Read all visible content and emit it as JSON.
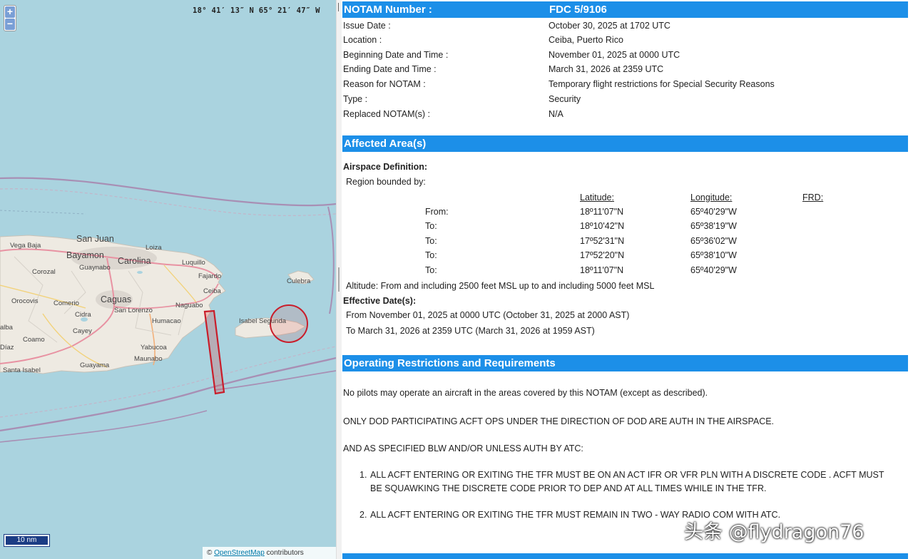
{
  "map": {
    "zoom_in": "+",
    "zoom_out": "−",
    "coordinates": "18° 41′ 13″ N 65° 21′ 47″ W",
    "scale": "10 nm",
    "attribution_symbol": "©",
    "attribution_link": "OpenStreetMap",
    "attribution_suffix": " contributors",
    "places": [
      {
        "name": "San Juan",
        "big": true
      },
      {
        "name": "Bayamon",
        "big": true
      },
      {
        "name": "Carolina",
        "big": true
      },
      {
        "name": "Caguas",
        "big": true
      },
      {
        "name": "Vega Baja"
      },
      {
        "name": "Loiza"
      },
      {
        "name": "Guaynabo"
      },
      {
        "name": "Luquillo"
      },
      {
        "name": "Corozal"
      },
      {
        "name": "Fajardo"
      },
      {
        "name": "Ceiba"
      },
      {
        "name": "Culebra"
      },
      {
        "name": "Orocovis"
      },
      {
        "name": "Comerio"
      },
      {
        "name": "Naguabo"
      },
      {
        "name": "Cidra"
      },
      {
        "name": "San Lorenzo"
      },
      {
        "name": "Humacao"
      },
      {
        "name": "Isabel Segunda"
      },
      {
        "name": "alba"
      },
      {
        "name": "Cayey"
      },
      {
        "name": "Coamo"
      },
      {
        "name": "Yabucoa"
      },
      {
        "name": "Díaz"
      },
      {
        "name": "Maunabo"
      },
      {
        "name": "Guayama"
      },
      {
        "name": "Santa Isabel"
      }
    ]
  },
  "notam": {
    "number_label": "NOTAM Number :",
    "number_value": "FDC 5/9106",
    "details": [
      {
        "label": "Issue Date :",
        "value": "October 30, 2025 at 1702 UTC"
      },
      {
        "label": "Location :",
        "value": "Ceiba, Puerto Rico"
      },
      {
        "label": "Beginning Date and Time :",
        "value": "November 01, 2025 at 0000 UTC"
      },
      {
        "label": "Ending Date and Time :",
        "value": "March 31, 2026 at 2359 UTC"
      },
      {
        "label": "Reason for NOTAM :",
        "value": "Temporary flight restrictions for Special Security Reasons"
      },
      {
        "label": "Type :",
        "value": "Security"
      },
      {
        "label": "Replaced NOTAM(s) :",
        "value": "N/A"
      }
    ],
    "affected_title": "Affected Area(s)",
    "airspace_def": "Airspace Definition:",
    "region_bounded": "Region bounded by:",
    "col_lat": "Latitude:",
    "col_lon": "Longitude:",
    "col_frd": "FRD:",
    "points": [
      {
        "label": "From:",
        "lat": "18º11'07\"N",
        "lon": "65º40'29\"W"
      },
      {
        "label": "To:",
        "lat": "18º10'42\"N",
        "lon": "65º38'19\"W"
      },
      {
        "label": "To:",
        "lat": "17º52'31\"N",
        "lon": "65º36'02\"W"
      },
      {
        "label": "To:",
        "lat": "17º52'20\"N",
        "lon": "65º38'10\"W"
      },
      {
        "label": "To:",
        "lat": "18º11'07\"N",
        "lon": "65º40'29\"W"
      }
    ],
    "altitude": "Altitude: From and including 2500 feet MSL up to and including 5000 feet MSL",
    "effective_label": "Effective Date(s):",
    "effective_from": "From November 01, 2025 at 0000 UTC (October 31, 2025 at 2000 AST)",
    "effective_to": "To March 31, 2026 at 2359 UTC (March 31, 2026 at 1959 AST)",
    "operating_title": "Operating Restrictions and Requirements",
    "para1": "No pilots may operate an aircraft in the areas covered by this NOTAM (except as described).",
    "para2": "ONLY DOD PARTICIPATING ACFT OPS UNDER THE DIRECTION OF DOD ARE AUTH IN THE AIRSPACE.",
    "para3": "AND AS SPECIFIED BLW AND/OR UNLESS AUTH BY ATC:",
    "items": [
      {
        "num": "1.",
        "line1": "ALL ACFT ENTERING OR EXITING THE TFR MUST BE ON AN ACT IFR OR VFR PLN WITH A DISCRETE CODE . ACFT MUST",
        "line2": "BE SQUAWKING THE DISCRETE CODE PRIOR TO DEP AND AT ALL TIMES WHILE IN THE TFR."
      },
      {
        "num": "2.",
        "line1": "ALL ACFT ENTERING OR EXITING THE TFR MUST REMAIN IN TWO - WAY RADIO COM WITH ATC."
      }
    ]
  },
  "watermark": "头条 @flydragon76"
}
